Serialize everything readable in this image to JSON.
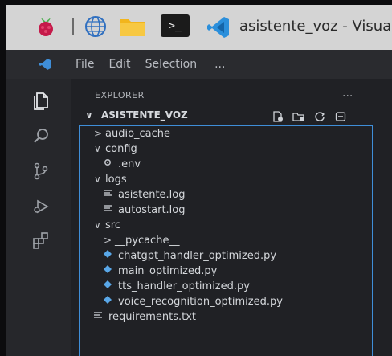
{
  "taskbar": {
    "window_title": "asistente_voz - Visua",
    "terminal_glyph": ">_"
  },
  "menubar": {
    "items": [
      "File",
      "Edit",
      "Selection"
    ],
    "more": "..."
  },
  "explorer": {
    "header": "EXPLORER",
    "more": "...",
    "root": {
      "chevron": "∨",
      "label": "ASISTENTE_VOZ"
    },
    "tree": [
      {
        "label": "audio_cache",
        "type": "folder",
        "chevron": ">"
      },
      {
        "label": "config",
        "type": "folder",
        "chevron": "∨"
      },
      {
        "label": ".env",
        "type": "gear-file"
      },
      {
        "label": "logs",
        "type": "folder",
        "chevron": "∨"
      },
      {
        "label": "asistente.log",
        "type": "log-file"
      },
      {
        "label": "autostart.log",
        "type": "log-file"
      },
      {
        "label": "src",
        "type": "folder",
        "chevron": "∨"
      },
      {
        "label": "__pycache__",
        "type": "folder",
        "chevron": ">"
      },
      {
        "label": "chatgpt_handler_optimized.py",
        "type": "python-file"
      },
      {
        "label": "main_optimized.py",
        "type": "python-file"
      },
      {
        "label": "tts_handler_optimized.py",
        "type": "python-file"
      },
      {
        "label": "voice_recognition_optimized.py",
        "type": "python-file"
      },
      {
        "label": "requirements.txt",
        "type": "text-file"
      }
    ]
  },
  "colors": {
    "accent": "#3f8ed8",
    "python_icon": "#59a7e8",
    "raspberry": "#c51a4a",
    "folder": "#f2b51c"
  }
}
